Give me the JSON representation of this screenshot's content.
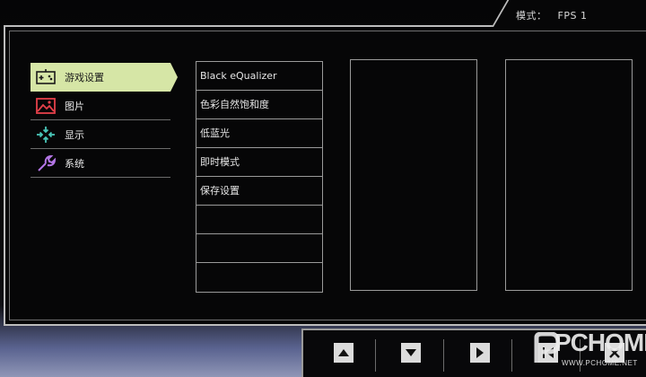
{
  "header": {
    "mode_label": "模式：",
    "mode_value": "FPS 1"
  },
  "left_menu": [
    {
      "label": "游戏设置",
      "icon": "gamepad-icon",
      "active": true
    },
    {
      "label": "图片",
      "icon": "picture-icon",
      "active": false
    },
    {
      "label": "显示",
      "icon": "display-icon",
      "active": false
    },
    {
      "label": "系统",
      "icon": "wrench-icon",
      "active": false
    }
  ],
  "sub_menu": [
    {
      "label": "Black eQualizer"
    },
    {
      "label": "色彩自然饱和度"
    },
    {
      "label": "低蓝光"
    },
    {
      "label": "即时模式"
    },
    {
      "label": "保存设置"
    },
    {
      "label": ""
    },
    {
      "label": ""
    },
    {
      "label": ""
    }
  ],
  "nav_buttons": [
    "up-arrow-icon",
    "down-arrow-icon",
    "right-arrow-icon",
    "exit-icon"
  ],
  "watermark": {
    "text": "PCHOME",
    "url": "WWW.PCHOME.NET"
  },
  "colors": {
    "active_item_bg": "#d6e6a6",
    "border": "#bdbdbd",
    "panel_bg": "#060607"
  }
}
